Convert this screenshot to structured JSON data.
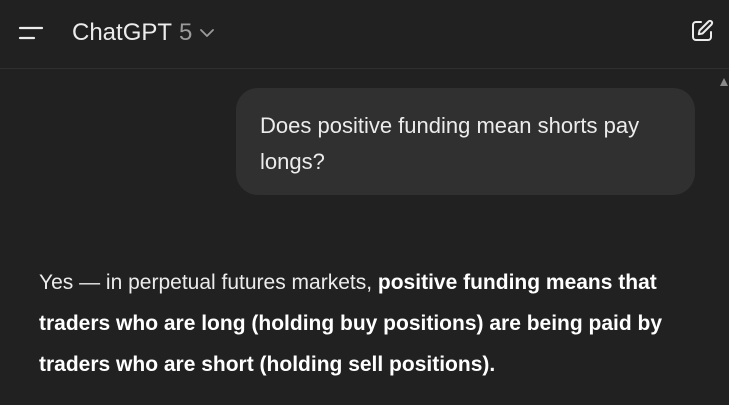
{
  "header": {
    "model_name": "ChatGPT",
    "model_version": "5",
    "menu_icon": "sidebar-menu-icon",
    "model_chevron_icon": "chevron-down-icon",
    "new_chat_icon": "edit-compose-icon"
  },
  "conversation": {
    "user_message": "Does positive funding mean shorts pay longs?",
    "assistant_message": {
      "plain_prefix": "Yes — in perpetual futures markets, ",
      "bold_text": "positive funding means that traders who are long (holding buy positions) are being paid by traders who are short (holding sell positions)."
    }
  },
  "colors": {
    "background": "#212121",
    "bubble": "#303030",
    "text": "#ececec",
    "muted": "#9b9b9b"
  }
}
